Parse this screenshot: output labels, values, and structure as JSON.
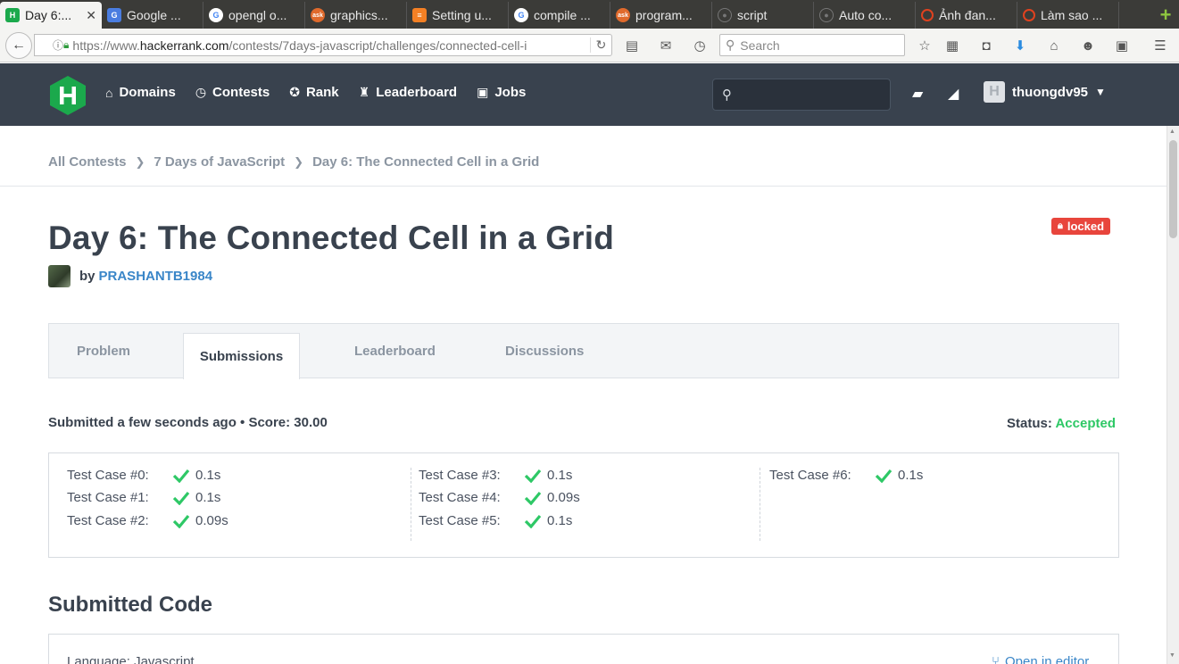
{
  "browser": {
    "tabs": [
      {
        "label": "Day 6:...",
        "icon": "hackerrank-favicon",
        "active": true
      },
      {
        "label": "Google ...",
        "icon": "google-translate-favicon"
      },
      {
        "label": "opengl o...",
        "icon": "google-favicon"
      },
      {
        "label": "graphics...",
        "icon": "ask-favicon"
      },
      {
        "label": "Setting u...",
        "icon": "stackoverflow-favicon"
      },
      {
        "label": "compile ...",
        "icon": "google-favicon"
      },
      {
        "label": "program...",
        "icon": "ask-favicon"
      },
      {
        "label": "script",
        "icon": "github-favicon"
      },
      {
        "label": "Auto co...",
        "icon": "github-favicon"
      },
      {
        "label": "Ảnh đan...",
        "icon": "opera-favicon"
      },
      {
        "label": "Làm sao ...",
        "icon": "opera-favicon"
      }
    ],
    "url_prefix": "https://www.",
    "url_domain": "hackerrank.com",
    "url_path": "/contests/7days-javascript/challenges/connected-cell-i",
    "search_placeholder": "Search"
  },
  "header": {
    "nav": [
      {
        "label": "Domains",
        "icon": "home-icon"
      },
      {
        "label": "Contests",
        "icon": "clock-icon"
      },
      {
        "label": "Rank",
        "icon": "medal-icon"
      },
      {
        "label": "Leaderboard",
        "icon": "trophy-icon"
      },
      {
        "label": "Jobs",
        "icon": "briefcase-icon"
      }
    ],
    "username": "thuongdv95"
  },
  "breadcrumb": [
    "All Contests",
    "7 Days of JavaScript",
    "Day 6: The Connected Cell in a Grid"
  ],
  "challenge": {
    "title": "Day 6: The Connected Cell in a Grid",
    "locked_label": "locked",
    "by_label": "by",
    "author": "PRASHANTB1984"
  },
  "tabs": [
    "Problem",
    "Submissions",
    "Leaderboard",
    "Discussions"
  ],
  "submission": {
    "summary": "Submitted a few seconds ago • Score: 30.00",
    "status_label": "Status:",
    "status_value": "Accepted",
    "status_color": "#2ec866",
    "test_cases": [
      {
        "label": "Test Case #0:",
        "time": "0.1s"
      },
      {
        "label": "Test Case #1:",
        "time": "0.1s"
      },
      {
        "label": "Test Case #2:",
        "time": "0.09s"
      },
      {
        "label": "Test Case #3:",
        "time": "0.1s"
      },
      {
        "label": "Test Case #4:",
        "time": "0.09s"
      },
      {
        "label": "Test Case #5:",
        "time": "0.1s"
      },
      {
        "label": "Test Case #6:",
        "time": "0.1s"
      }
    ]
  },
  "code": {
    "title": "Submitted Code",
    "language": "Language: Javascript",
    "open_editor": "Open in editor"
  }
}
